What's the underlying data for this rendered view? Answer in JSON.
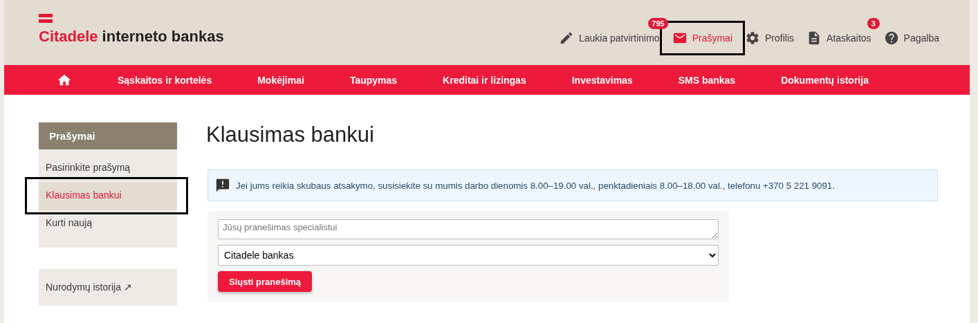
{
  "logo": {
    "brand": "Citadele",
    "suffix": "interneto bankas"
  },
  "top_links": [
    {
      "kind": "pencil",
      "label": "Laukia patvirtinimo",
      "badge": "795",
      "selected": false,
      "highlighted": false
    },
    {
      "kind": "mail",
      "label": "Prašymai",
      "selected": true,
      "highlighted": true
    },
    {
      "kind": "gear",
      "label": "Profilis",
      "selected": false,
      "highlighted": false
    },
    {
      "kind": "document",
      "label": "Ataskaitos",
      "badge": "3",
      "selected": false,
      "highlighted": false
    },
    {
      "kind": "help",
      "label": "Pagalba",
      "selected": false,
      "highlighted": false
    }
  ],
  "nav": {
    "items": [
      "Sąskaitos ir kortelės",
      "Mokėjimai",
      "Taupymas",
      "Kreditai ir lizingas",
      "Investavimas",
      "SMS bankas",
      "Dokumentų istorija"
    ]
  },
  "sidebar": {
    "title": "Prašymai",
    "items": [
      {
        "label": "Pasirinkite prašymą",
        "selected": false,
        "highlighted": false
      },
      {
        "label": "Klausimas bankui",
        "selected": true,
        "highlighted": true
      },
      {
        "label": "Kurti naują",
        "selected": false,
        "highlighted": false
      }
    ],
    "external_link": "Nurodymų istorija ↗"
  },
  "page_title": "Klausimas bankui",
  "info": "Jei jums reikia skubaus atsakymo, susisiekite su mumis darbo dienomis 8.00–19.00 val., penktadieniais 8.00–18.00 val., telefonu +370 5 221 9091.",
  "form": {
    "message": {
      "placeholder": "Jūsų pranešimas specialistui"
    },
    "recipient": {
      "value": "Citadele bankas"
    },
    "submit": "Siųsti pranešimą"
  }
}
